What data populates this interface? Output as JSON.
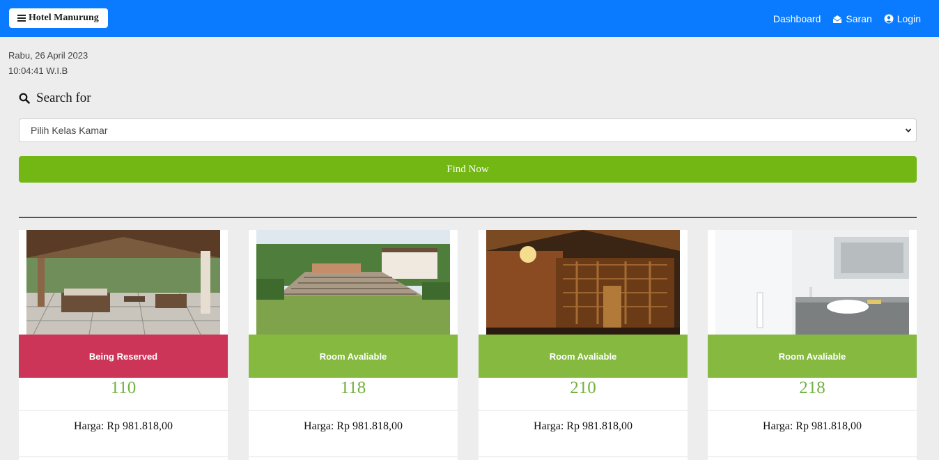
{
  "navbar": {
    "brand": "Hotel Manurung",
    "links": [
      {
        "label": "Dashboard",
        "icon": ""
      },
      {
        "label": "Saran",
        "icon": "envelope-open-icon"
      },
      {
        "label": "Login",
        "icon": "user-circle-icon"
      }
    ],
    "bg_color": "#0a7bff"
  },
  "clock": {
    "date": "Rabu, 26 April 2023",
    "time": "10:04:41 W.I.B"
  },
  "search": {
    "label": "Search for",
    "select_value": "Pilih Kelas Kamar",
    "button_label": "Find Now",
    "button_color": "#72b714"
  },
  "rooms": [
    {
      "status": "Being Reserved",
      "status_color": "#cc3557",
      "number": "110",
      "price": "Harga: Rp 981.818,00",
      "image": "pavilion-lounge"
    },
    {
      "status": "Room Avaliable",
      "status_color": "#86b940",
      "number": "118",
      "price": "Harga: Rp 981.818,00",
      "image": "garden-steps"
    },
    {
      "status": "Room Avaliable",
      "status_color": "#86b940",
      "number": "210",
      "price": "Harga: Rp 981.818,00",
      "image": "carved-wood-hall"
    },
    {
      "status": "Room Avaliable",
      "status_color": "#86b940",
      "number": "218",
      "price": "Harga: Rp 981.818,00",
      "image": "white-bathroom"
    }
  ]
}
